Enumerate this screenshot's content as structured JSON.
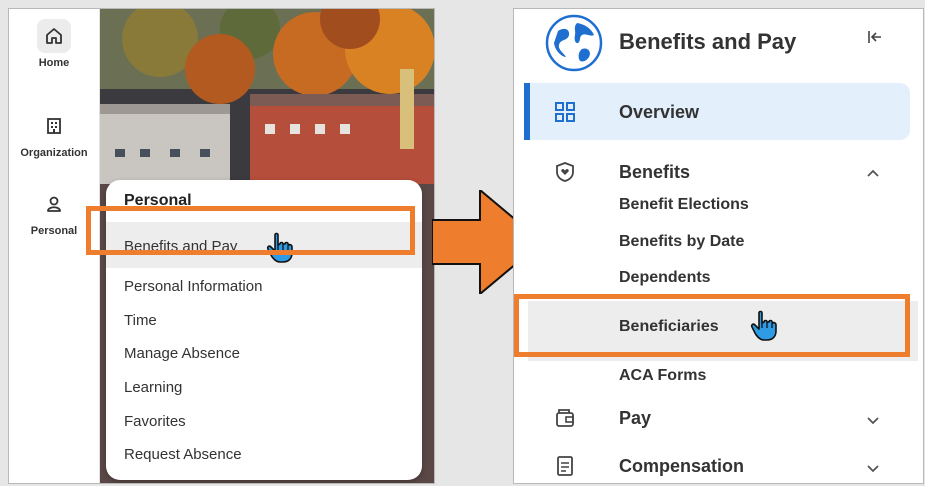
{
  "left": {
    "rail": [
      {
        "label": "Home",
        "icon": "home-icon"
      },
      {
        "label": "Organization",
        "icon": "building-icon"
      },
      {
        "label": "Personal",
        "icon": "person-icon"
      }
    ],
    "menu": {
      "title": "Personal",
      "items": [
        "Benefits and Pay",
        "Personal Information",
        "Time",
        "Manage Absence",
        "Learning",
        "Favorites",
        "Request Absence"
      ]
    }
  },
  "right": {
    "title": "Benefits and Pay",
    "overview": "Overview",
    "benefits": {
      "label": "Benefits",
      "items": [
        "Benefit Elections",
        "Benefits by Date",
        "Dependents",
        "Beneficiaries",
        "ACA Forms"
      ]
    },
    "pay": "Pay",
    "compensation": "Compensation"
  },
  "colors": {
    "highlight": "#ee7d2d",
    "accent": "#1f6fd1"
  },
  "icons": {
    "arrow": "arrow-right-icon",
    "cursor": "hand-pointer-icon"
  }
}
